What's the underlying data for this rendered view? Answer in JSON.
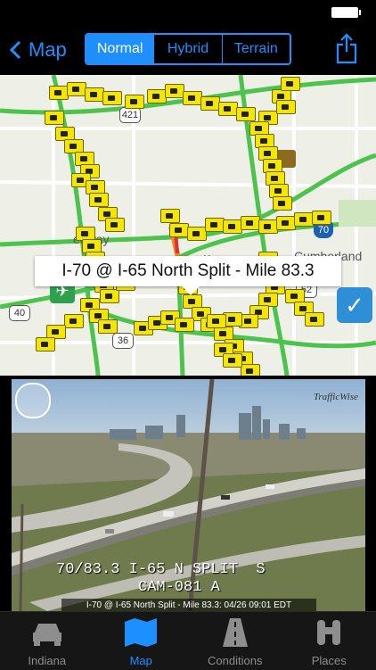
{
  "nav": {
    "back_label": "Map",
    "segments": [
      "Normal",
      "Hybrid",
      "Terrain"
    ],
    "active_segment": "Normal"
  },
  "map": {
    "callout": "I-70 @ I-65 North Split - Mile 83.3",
    "labels": {
      "city": "olis",
      "cumberland": "Cumberland",
      "speedway": "edway"
    },
    "shields": [
      "421",
      "70",
      "52",
      "40",
      "36"
    ]
  },
  "camera": {
    "overlay_line1": "70/83.3 I-65 N SPLIT  S",
    "overlay_line2": "CAM-081 A",
    "caption": "I-70 @ I-65 North Split - Mile 83.3: 04/26 09:01 EDT",
    "logo": "TrafficWise"
  },
  "tabs": [
    {
      "label": "Indiana",
      "icon": "car-icon"
    },
    {
      "label": "Map",
      "icon": "map-icon"
    },
    {
      "label": "Conditions",
      "icon": "road-icon"
    },
    {
      "label": "Places",
      "icon": "binoculars-icon"
    }
  ],
  "active_tab": "Map",
  "colors": {
    "accent": "#1e8fff",
    "camera_marker": "#f5e600",
    "freeway_flow": "#4cc34c"
  }
}
